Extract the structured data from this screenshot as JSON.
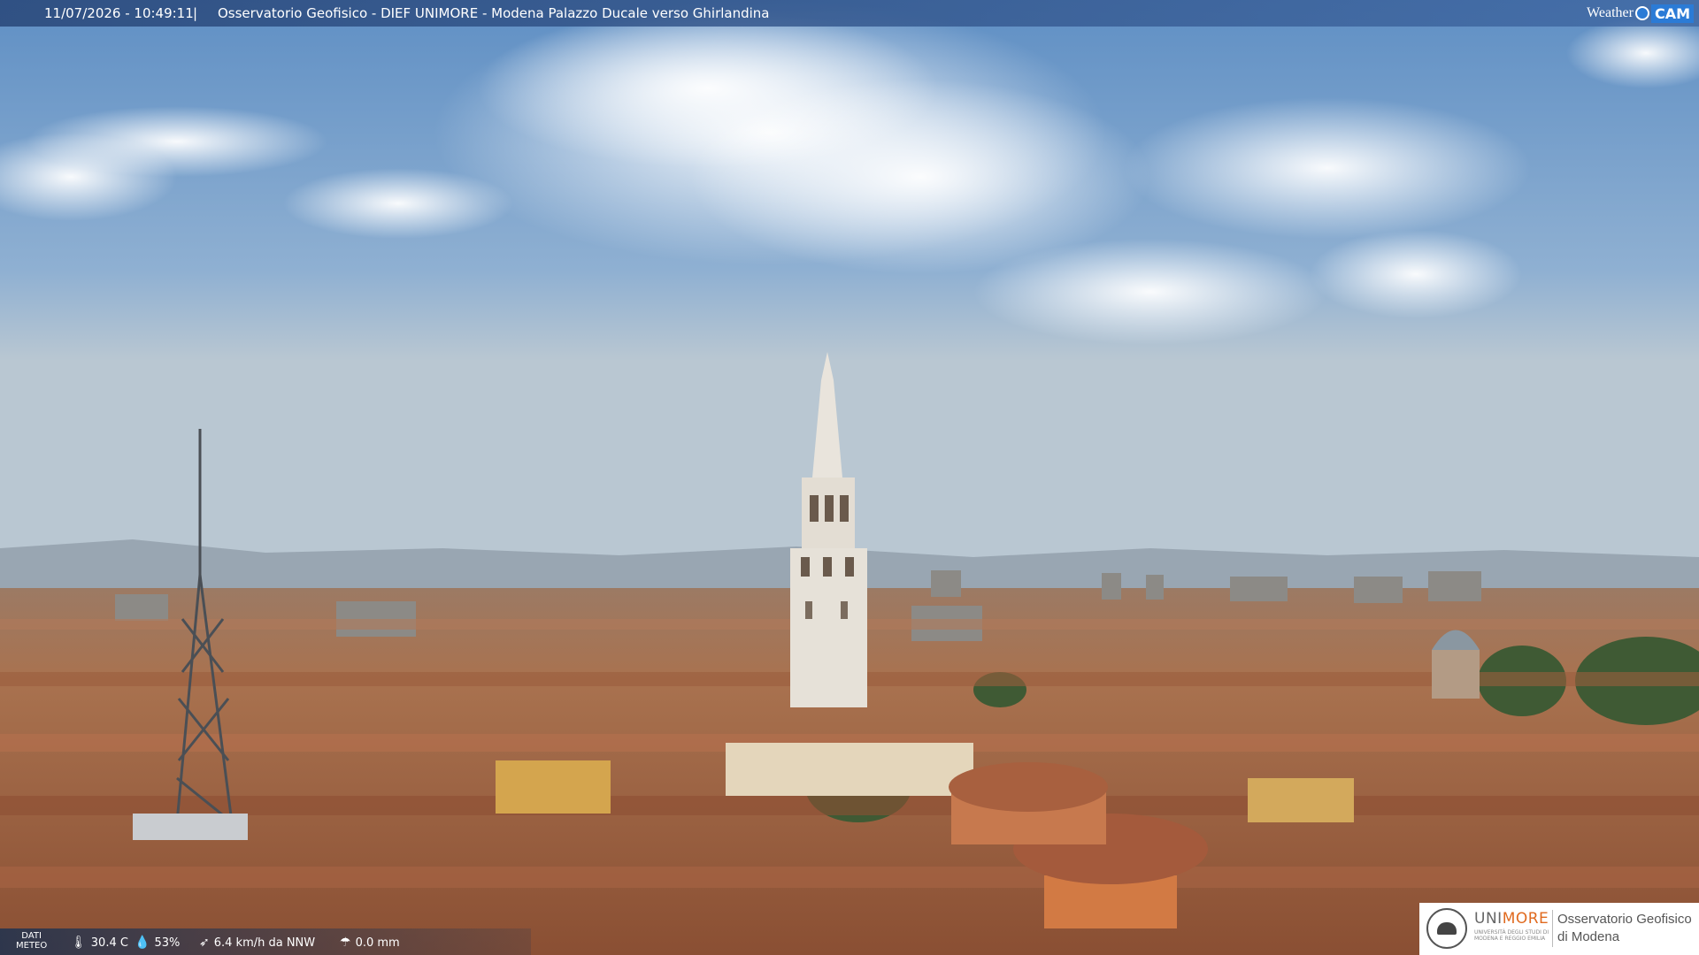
{
  "header": {
    "timestamp": "11/07/2026 - 10:49:11",
    "separator": "|",
    "title": "Osservatorio Geofisico - DIEF UNIMORE - Modena Palazzo Ducale verso Ghirlandina"
  },
  "brand": {
    "weather": "Weather",
    "cam": "CAM",
    "icon": "camera-icon"
  },
  "footer": {
    "label_line1": "DATI",
    "label_line2": "METEO",
    "temperature": "30.4 C",
    "temperature_icon": "thermometer-icon",
    "humidity": "53%",
    "humidity_icon": "droplet-icon",
    "wind": "6.4 km/h da NNW",
    "wind_icon": "wind-icon",
    "rain": "0.0 mm",
    "rain_icon": "rain-icon"
  },
  "logo": {
    "university": "UNI",
    "university_accent": "MORE",
    "university_sub": "UNIVERSITÀ DEGLI STUDI DI MODENA E REGGIO EMILIA",
    "observatory_line1": "Osservatorio Geofisico",
    "observatory_line2": "di Modena"
  },
  "colors": {
    "sky_top": "#5f8fc4",
    "sky_bottom": "#b9c7d2",
    "roofs": "#b07050",
    "tower": "#e6e1d8",
    "logo_accent": "#e06a1f"
  }
}
